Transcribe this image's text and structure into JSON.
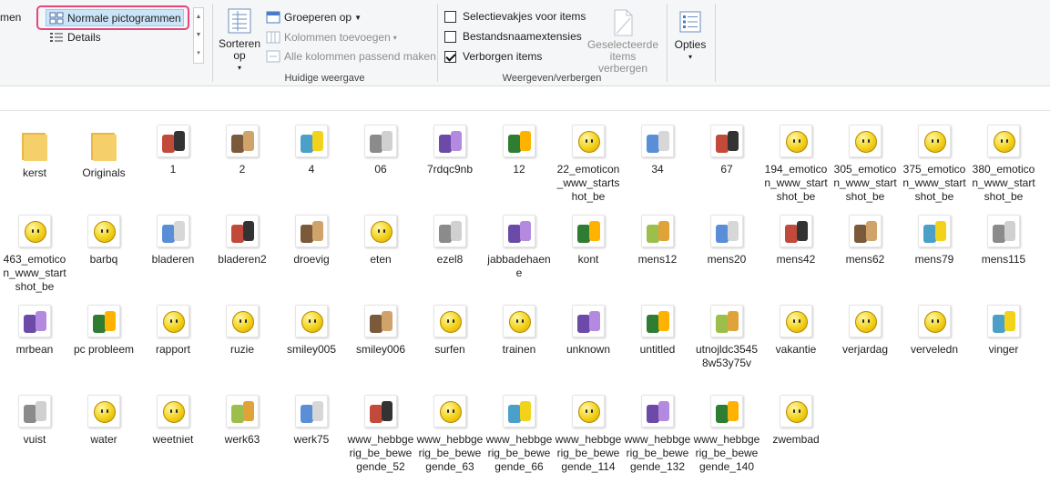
{
  "ribbon": {
    "layout": {
      "partial_label": "men",
      "normal_icons": "Normale pictogrammen",
      "details": "Details"
    },
    "current_view": {
      "sort_by": "Sorteren op",
      "group_by": "Groeperen op",
      "add_columns": "Kolommen toevoegen",
      "size_all_columns": "Alle kolommen passend maken",
      "group_label": "Huidige weergave"
    },
    "show_hide": {
      "item_checkboxes": "Selectievakjes voor items",
      "item_checkboxes_checked": false,
      "file_name_extensions": "Bestandsnaamextensies",
      "file_name_extensions_checked": false,
      "hidden_items": "Verborgen items",
      "hidden_items_checked": true,
      "hide_selected": "Geselecteerde items verbergen",
      "group_label": "Weergeven/verbergen"
    },
    "options": "Opties",
    "colors": {
      "highlight": "#e8457a",
      "selected_bg": "#cce4f7"
    }
  },
  "files": [
    {
      "name": "kerst",
      "icon": "folder-icon"
    },
    {
      "name": "Originals",
      "icon": "folder-icon"
    },
    {
      "name": "1",
      "icon": "image-thumbnail-icon"
    },
    {
      "name": "2",
      "icon": "image-thumbnail-icon"
    },
    {
      "name": "4",
      "icon": "image-thumbnail-icon"
    },
    {
      "name": "06",
      "icon": "image-thumbnail-icon"
    },
    {
      "name": "7rdqc9nb",
      "icon": "image-thumbnail-icon"
    },
    {
      "name": "12",
      "icon": "image-thumbnail-icon"
    },
    {
      "name": "22_emoticon_www_startshot_be",
      "icon": "smiley-thumbnail-icon"
    },
    {
      "name": "34",
      "icon": "image-thumbnail-icon"
    },
    {
      "name": "67",
      "icon": "image-thumbnail-icon"
    },
    {
      "name": "194_emoticon_www_startshot_be",
      "icon": "smiley-thumbnail-icon"
    },
    {
      "name": "305_emoticon_www_startshot_be",
      "icon": "smiley-thumbnail-icon"
    },
    {
      "name": "375_emoticon_www_startshot_be",
      "icon": "smiley-thumbnail-icon"
    },
    {
      "name": "380_emoticon_www_startshot_be",
      "icon": "smiley-thumbnail-icon"
    },
    {
      "name": "463_emoticon_www_startshot_be",
      "icon": "smiley-thumbnail-icon"
    },
    {
      "name": "barbq",
      "icon": "smiley-thumbnail-icon"
    },
    {
      "name": "bladeren",
      "icon": "image-thumbnail-icon"
    },
    {
      "name": "bladeren2",
      "icon": "image-thumbnail-icon"
    },
    {
      "name": "droevig",
      "icon": "image-thumbnail-icon"
    },
    {
      "name": "eten",
      "icon": "smiley-thumbnail-icon"
    },
    {
      "name": "ezel8",
      "icon": "image-thumbnail-icon"
    },
    {
      "name": "jabbadehaene",
      "icon": "image-thumbnail-icon"
    },
    {
      "name": "kont",
      "icon": "image-thumbnail-icon"
    },
    {
      "name": "mens12",
      "icon": "image-thumbnail-icon"
    },
    {
      "name": "mens20",
      "icon": "image-thumbnail-icon"
    },
    {
      "name": "mens42",
      "icon": "image-thumbnail-icon"
    },
    {
      "name": "mens62",
      "icon": "image-thumbnail-icon"
    },
    {
      "name": "mens79",
      "icon": "image-thumbnail-icon"
    },
    {
      "name": "mens115",
      "icon": "image-thumbnail-icon"
    },
    {
      "name": "mrbean",
      "icon": "image-thumbnail-icon"
    },
    {
      "name": "pc probleem",
      "icon": "image-thumbnail-icon"
    },
    {
      "name": "rapport",
      "icon": "smiley-thumbnail-icon"
    },
    {
      "name": "ruzie",
      "icon": "smiley-thumbnail-icon"
    },
    {
      "name": "smiley005",
      "icon": "smiley-thumbnail-icon"
    },
    {
      "name": "smiley006",
      "icon": "image-thumbnail-icon"
    },
    {
      "name": "surfen",
      "icon": "smiley-thumbnail-icon"
    },
    {
      "name": "trainen",
      "icon": "smiley-thumbnail-icon"
    },
    {
      "name": "unknown",
      "icon": "image-thumbnail-icon"
    },
    {
      "name": "untitled",
      "icon": "image-thumbnail-icon"
    },
    {
      "name": "utnojldc35458w53y75v",
      "icon": "image-thumbnail-icon"
    },
    {
      "name": "vakantie",
      "icon": "smiley-thumbnail-icon"
    },
    {
      "name": "verjardag",
      "icon": "smiley-thumbnail-icon"
    },
    {
      "name": "verveledn",
      "icon": "smiley-thumbnail-icon"
    },
    {
      "name": "vinger",
      "icon": "image-thumbnail-icon"
    },
    {
      "name": "vuist",
      "icon": "image-thumbnail-icon"
    },
    {
      "name": "water",
      "icon": "smiley-thumbnail-icon"
    },
    {
      "name": "weetniet",
      "icon": "smiley-thumbnail-icon"
    },
    {
      "name": "werk63",
      "icon": "image-thumbnail-icon"
    },
    {
      "name": "werk75",
      "icon": "image-thumbnail-icon"
    },
    {
      "name": "www_hebbgerig_be_bewegende_52",
      "icon": "image-thumbnail-icon"
    },
    {
      "name": "www_hebbgerig_be_bewegende_63",
      "icon": "smiley-thumbnail-icon"
    },
    {
      "name": "www_hebbgerig_be_bewegende_66",
      "icon": "image-thumbnail-icon"
    },
    {
      "name": "www_hebbgerig_be_bewegende_114",
      "icon": "smiley-thumbnail-icon"
    },
    {
      "name": "www_hebbgerig_be_bewegende_132",
      "icon": "image-thumbnail-icon"
    },
    {
      "name": "www_hebbgerig_be_bewegende_140",
      "icon": "image-thumbnail-icon"
    },
    {
      "name": "zwembad",
      "icon": "smiley-thumbnail-icon"
    }
  ]
}
